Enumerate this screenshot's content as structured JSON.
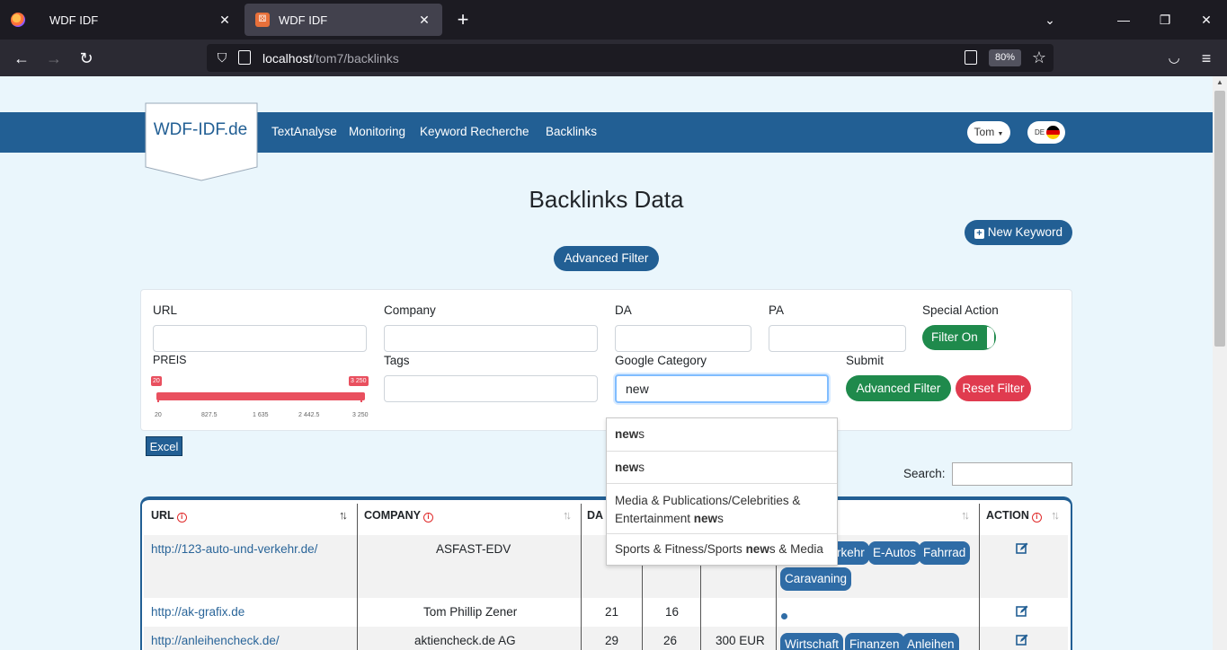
{
  "browser": {
    "tabs": [
      {
        "title": "WDF IDF",
        "active": false
      },
      {
        "title": "WDF IDF",
        "active": true
      }
    ],
    "url_host": "localhost",
    "url_path": "/tom7/backlinks",
    "zoom": "80%"
  },
  "site": {
    "logo": "WDF-IDF.de",
    "nav": [
      "TextAnalyse",
      "Monitoring",
      "Keyword Recherche",
      "Backlinks"
    ],
    "user": "Tom",
    "lang": "DE"
  },
  "page": {
    "title": "Backlinks Data",
    "new_keyword": "New Keyword",
    "advanced_filter_toggle": "Advanced Filter",
    "excel": "Excel",
    "search_label": "Search:"
  },
  "filters": {
    "url_label": "URL",
    "company_label": "Company",
    "da_label": "DA",
    "pa_label": "PA",
    "special_label": "Special Action",
    "special_toggle": "Filter On",
    "preis_label": "PREIS",
    "tags_label": "Tags",
    "category_label": "Google Category",
    "category_value": "new",
    "submit_label": "Submit",
    "submit_btn": "Advanced Filter",
    "reset_btn": "Reset Filter",
    "slider_min": "20",
    "slider_max": "3 250",
    "slider_ticks": [
      "20",
      "827.5",
      "1 635",
      "2 442.5",
      "3 250"
    ]
  },
  "autocomplete": [
    {
      "match": "new",
      "rest": "s",
      "pre": ""
    },
    {
      "match": "new",
      "rest": "s",
      "pre": ""
    },
    {
      "pre": "Media & Publications/Celebrities & Entertainment ",
      "match": "new",
      "rest": "s"
    },
    {
      "pre": "Sports & Fitness/Sports ",
      "match": "new",
      "rest": "s & Media"
    }
  ],
  "table": {
    "headers": [
      "URL",
      "COMPANY",
      "DA",
      "ACTION"
    ],
    "rows": [
      {
        "url": "http://123-auto-und-verkehr.de/",
        "company": "ASFAST-EDV",
        "da": "",
        "pa": "",
        "price": "",
        "tags": [
          "rkehr",
          "E-Autos",
          "Fahrrad",
          "Caravaning"
        ]
      },
      {
        "url": "http://ak-grafix.de",
        "company": "Tom Phillip Zener",
        "da": "21",
        "pa": "16",
        "price": "",
        "tags": []
      },
      {
        "url": "http://anleihencheck.de/",
        "company": "aktiencheck.de AG",
        "da": "29",
        "pa": "26",
        "price": "300 EUR",
        "tags": [
          "Wirtschaft",
          "Finanzen",
          "Anleihen"
        ]
      }
    ]
  },
  "colors": {
    "brand": "#225f94",
    "green": "#1f8a4c",
    "red": "#e03b4f"
  }
}
